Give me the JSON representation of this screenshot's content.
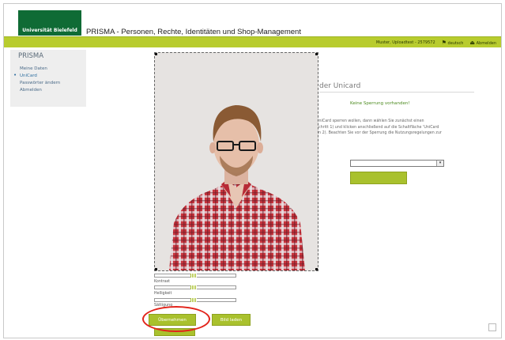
{
  "header": {
    "logo_text": "Universität Bielefeld",
    "app_title": "PRISMA - Personen, Rechte, Identitäten und Shop-Management"
  },
  "user_bar": {
    "user_text": "Muster, Uploadtest - 2579572",
    "language_label": "deutsch",
    "logout_label": "Abmelden",
    "language_icon": "language-icon",
    "logout_icon": "logout-icon"
  },
  "sidebar": {
    "title": "PRISMA",
    "items": [
      {
        "label": "Meine Daten"
      },
      {
        "label": "UniCard"
      },
      {
        "label": "Passwörter ändern"
      },
      {
        "label": "Abmelden"
      }
    ],
    "active_index": 1
  },
  "unicard": {
    "title": "der Unicard",
    "status": "Keine Sperrung vorhanden!",
    "info_lines": [
      "UniCard sperren wollen, dann wählen Sie zunächst einen",
      "Schritt 1) und klicken anschließend auf die Schaltfläche 'UniCard",
      "nn 2). Beachten Sie vor der Sperrung die Nutzungsregelungen zur"
    ],
    "select_value": ""
  },
  "photo_editor": {
    "sliders": [
      {
        "label": "Kontrast",
        "value": 0.5
      },
      {
        "label": "Helligkeit",
        "value": 0.5
      },
      {
        "label": "Sättigung",
        "value": 0.5
      }
    ],
    "apply_button": "Übernehmen",
    "upload_button": "Bild laden"
  },
  "colors": {
    "brand_green": "#0f6b35",
    "accent_lime": "#a9c12d",
    "highlight_red": "#e2231a"
  }
}
